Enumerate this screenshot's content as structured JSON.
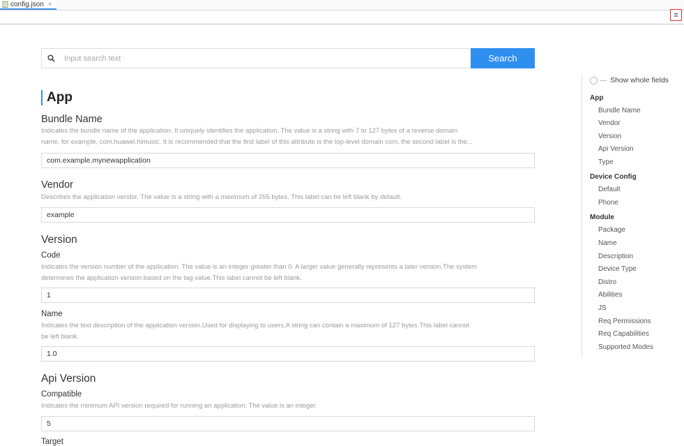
{
  "tab": {
    "label": "config.json",
    "close": "×"
  },
  "menu_icon": "≡",
  "search": {
    "placeholder": "Input search text",
    "button": "Search"
  },
  "section": {
    "title": "App"
  },
  "fields": {
    "bundle_name": {
      "title": "Bundle Name",
      "desc1": "Indicates the bundle name of the application. It uniquely identifies the application. The value is a string with 7 to 127 bytes of a reverse domain",
      "desc2": "name, for example, com.huawei.himusic. It is recommended that the first label of this attribute is the top-level domain com, the second label is the...",
      "value": "com.example.mynewapplication"
    },
    "vendor": {
      "title": "Vendor",
      "desc1": "Describes the application vendor. The value is a string with a maximum of 255 bytes. This label can be left blank by default.",
      "value": "example"
    },
    "version": {
      "title": "Version",
      "code": {
        "title": "Code",
        "desc1": "Indicates the version number of the application. The value is an integer greater than 0. A larger value generally represents a later version.The system",
        "desc2": "determines the application version based on the tag value.This label cannot be left blank.",
        "value": "1"
      },
      "name": {
        "title": "Name",
        "desc1": "Indicates the text description of the application version.Used for displaying to users.A string can contain a maximum of 127 bytes.This label cannot",
        "desc2": "be left blank.",
        "value": "1.0"
      }
    },
    "api_version": {
      "title": "Api Version",
      "compatible": {
        "title": "Compatible",
        "desc1": "Indicates the minimum API version required for running an application. The value is an integer.",
        "value": "5"
      },
      "cut_label": "Target"
    }
  },
  "sidebar": {
    "toggle_label": "Show whole fields",
    "groups": [
      {
        "label": "App",
        "items": [
          "Bundle Name",
          "Vendor",
          "Version",
          "Api Version",
          "Type"
        ]
      },
      {
        "label": "Device Config",
        "items": [
          "Default",
          "Phone"
        ]
      },
      {
        "label": "Module",
        "items": [
          "Package",
          "Name",
          "Description",
          "Device Type",
          "Distro",
          "Abilities",
          "JS",
          "Req Permissions",
          "Req Capabilities",
          "Supported Modes"
        ]
      }
    ]
  },
  "colors": {
    "accent": "#2f8ff0",
    "highlight_border": "#e03030"
  }
}
